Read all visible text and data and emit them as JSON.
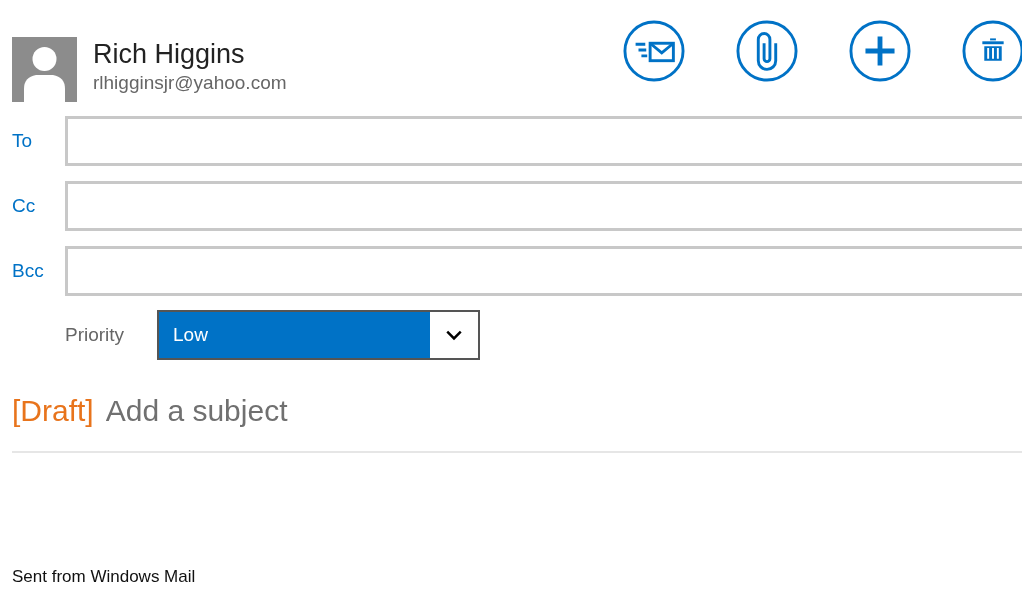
{
  "sender": {
    "name": "Rich Higgins",
    "email": "rlhigginsjr@yahoo.com"
  },
  "toolbar": [
    {
      "kind": "send"
    },
    {
      "kind": "attach"
    },
    {
      "kind": "add"
    },
    {
      "kind": "delete"
    }
  ],
  "recipients": [
    {
      "label": "To"
    },
    {
      "label": "Cc"
    },
    {
      "label": "Bcc"
    }
  ],
  "priority": {
    "label": "Priority",
    "value": "Low"
  },
  "subject": {
    "tag": "[Draft]",
    "placeholder": "Add a subject"
  },
  "body": "Sent from Windows Mail"
}
